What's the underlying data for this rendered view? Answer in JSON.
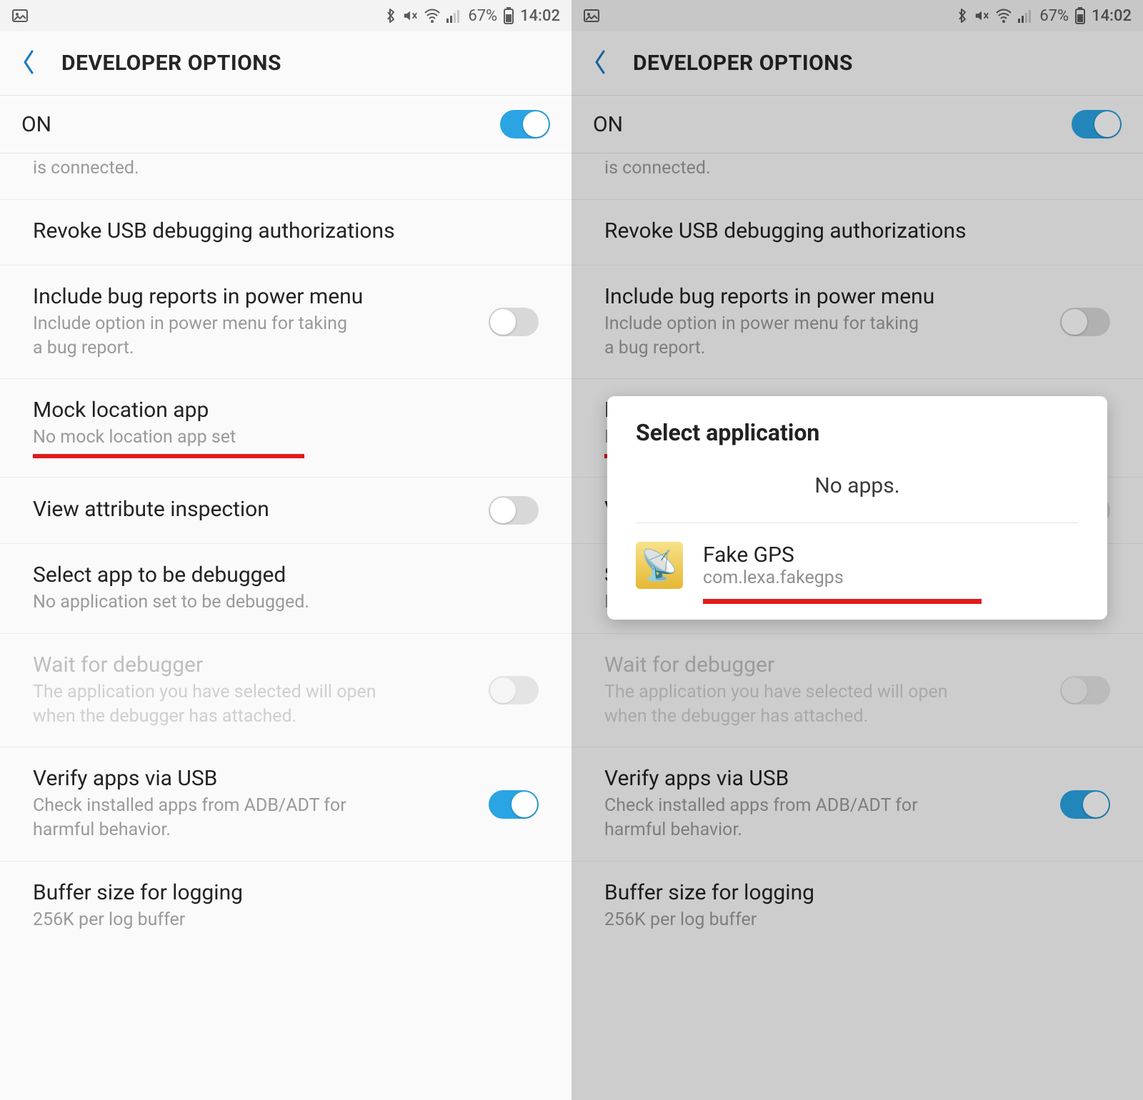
{
  "status": {
    "battery_pct": "67%",
    "time": "14:02"
  },
  "header": {
    "title": "DEVELOPER OPTIONS"
  },
  "on_row": {
    "label": "ON"
  },
  "items": {
    "connected_tail": "is connected.",
    "revoke": "Revoke USB debugging authorizations",
    "bugreport_title": "Include bug reports in power menu",
    "bugreport_sub": "Include option in power menu for taking\na bug report.",
    "mock_title": "Mock location app",
    "mock_sub": "No mock location app set",
    "viewattr": "View attribute inspection",
    "selectdbg_title": "Select app to be debugged",
    "selectdbg_sub": "No application set to be debugged.",
    "waitdbg_title": "Wait for debugger",
    "waitdbg_sub": "The application you have selected will open\nwhen the debugger has attached.",
    "verifyusb_title": "Verify apps via USB",
    "verifyusb_sub": "Check installed apps from ADB/ADT for\nharmful behavior.",
    "buffer_title": "Buffer size for logging",
    "buffer_sub": "256K per log buffer"
  },
  "dialog": {
    "title": "Select application",
    "no_apps": "No apps.",
    "app_name": "Fake GPS",
    "app_pkg": "com.lexa.fakegps"
  }
}
